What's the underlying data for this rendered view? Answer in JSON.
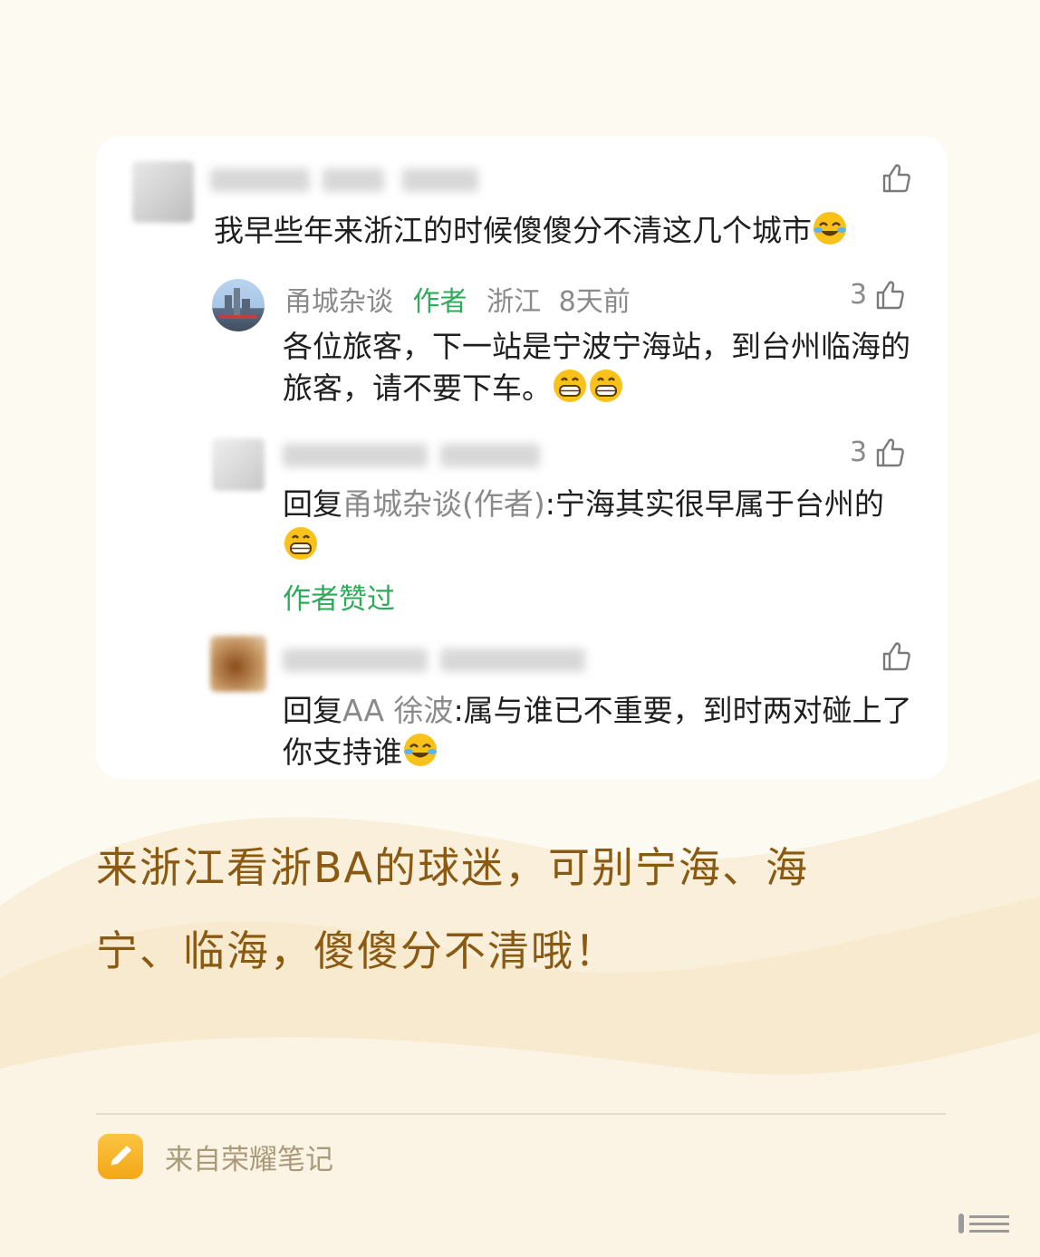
{
  "colors": {
    "background": "#fdfbf1",
    "caption": "#8a5a12",
    "author_green": "#2eab5a",
    "gray_text": "#8a8a8a",
    "footer_icon": "#f7b21a"
  },
  "comments": {
    "top": {
      "text": "我早些年来浙江的时候傻傻分不清这几个城市",
      "emoji": "face-with-tears-of-joy"
    },
    "reply1": {
      "name": "甬城杂谈",
      "author_tag": "作者",
      "location": "浙江",
      "time": "8天前",
      "likes": "3",
      "text": "各位旅客，下一站是宁波宁海站，到台州临海的旅客，请不要下车。",
      "emoji": "grinning-face"
    },
    "reply2": {
      "likes": "3",
      "reply_prefix": "回复",
      "reply_target": "甬城杂谈(作者)",
      "text": ":宁海其实很早属于台州的",
      "emoji": "grinning-face",
      "author_liked": "作者赞过"
    },
    "reply3": {
      "reply_prefix": "回复",
      "reply_target": "AA 徐波",
      "text": ":属与谁已不重要，到时两对碰上了你支持谁",
      "emoji": "face-with-tears-of-joy"
    }
  },
  "caption": {
    "line1": "来浙江看浙BA的球迷，可别宁海、海",
    "line2": "宁、临海，傻傻分不清哦！"
  },
  "footer": {
    "source": "来自荣耀笔记",
    "icon": "pen-note-icon"
  }
}
